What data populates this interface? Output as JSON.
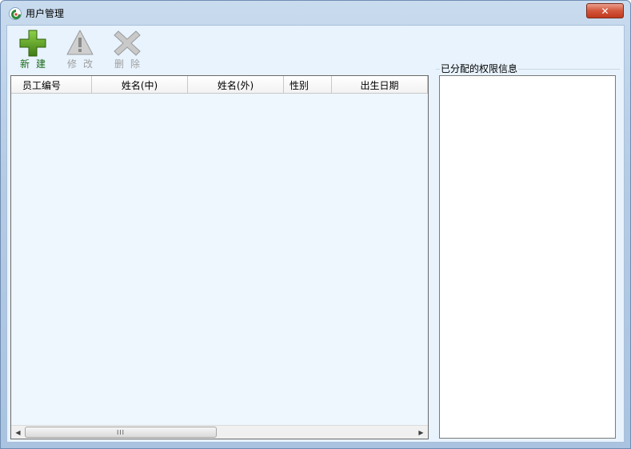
{
  "window": {
    "title": "用户管理",
    "close_glyph": "✕",
    "icon": "app-swirl-icon"
  },
  "toolbar": {
    "new": {
      "label": "新建",
      "icon": "plus-icon",
      "enabled": true
    },
    "edit": {
      "label": "修改",
      "icon": "warning-icon",
      "enabled": false
    },
    "delete": {
      "label": "删除",
      "icon": "x-icon",
      "enabled": false
    }
  },
  "user_table": {
    "columns": [
      "员工编号",
      "姓名(中)",
      "姓名(外)",
      "性别",
      "出生日期"
    ],
    "rows": [],
    "scrollbar": {
      "left_arrow": "◀",
      "right_arrow": "▶",
      "thumb_grip": "III"
    }
  },
  "permissions": {
    "label": "已分配的权限信息"
  },
  "colors": {
    "client_bg": "#e8f3fd",
    "new_green": "#5a9a1a",
    "close_red": "#d2553b"
  }
}
